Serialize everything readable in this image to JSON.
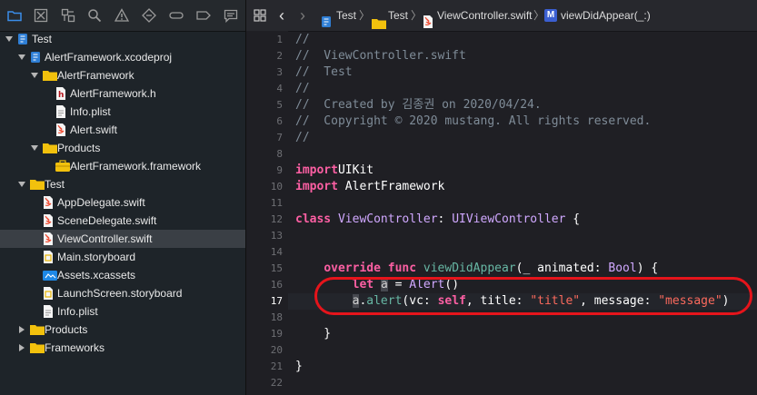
{
  "navigator": {
    "toolbar_icons": [
      "folder-icon",
      "source-control-icon",
      "symbol-icon",
      "find-icon",
      "issue-icon",
      "test-icon",
      "debug-icon",
      "breakpoint-icon",
      "report-icon"
    ],
    "tree": [
      {
        "label": "Test",
        "icon": "project-file",
        "depth": 0,
        "expanded": true
      },
      {
        "label": "AlertFramework.xcodeproj",
        "icon": "project-file",
        "depth": 1,
        "expanded": true
      },
      {
        "label": "AlertFramework",
        "icon": "folder",
        "depth": 2,
        "expanded": true
      },
      {
        "label": "AlertFramework.h",
        "icon": "header-file",
        "depth": 3
      },
      {
        "label": "Info.plist",
        "icon": "plist-file",
        "depth": 3
      },
      {
        "label": "Alert.swift",
        "icon": "swift-file",
        "depth": 3
      },
      {
        "label": "Products",
        "icon": "folder",
        "depth": 2,
        "expanded": true
      },
      {
        "label": "AlertFramework.framework",
        "icon": "framework-file",
        "depth": 3
      },
      {
        "label": "Test",
        "icon": "folder",
        "depth": 1,
        "expanded": true
      },
      {
        "label": "AppDelegate.swift",
        "icon": "swift-file",
        "depth": 2
      },
      {
        "label": "SceneDelegate.swift",
        "icon": "swift-file",
        "depth": 2
      },
      {
        "label": "ViewController.swift",
        "icon": "swift-file",
        "depth": 2,
        "selected": true
      },
      {
        "label": "Main.storyboard",
        "icon": "storyboard-file",
        "depth": 2
      },
      {
        "label": "Assets.xcassets",
        "icon": "assets-file",
        "depth": 2
      },
      {
        "label": "LaunchScreen.storyboard",
        "icon": "storyboard-file",
        "depth": 2
      },
      {
        "label": "Info.plist",
        "icon": "plist-file",
        "depth": 2
      },
      {
        "label": "Products",
        "icon": "folder",
        "depth": 1,
        "expanded": false
      },
      {
        "label": "Frameworks",
        "icon": "folder",
        "depth": 1,
        "expanded": false
      }
    ]
  },
  "jumpbar": {
    "crumbs": [
      "Test",
      "Test",
      "ViewController.swift",
      "viewDidAppear(_:)"
    ],
    "method_badge": "M"
  },
  "editor": {
    "current_line": 17,
    "lines": [
      {
        "n": "1",
        "t": [
          [
            "cm",
            "//"
          ]
        ]
      },
      {
        "n": "2",
        "t": [
          [
            "cm",
            "//  ViewController.swift"
          ]
        ]
      },
      {
        "n": "3",
        "t": [
          [
            "cm",
            "//  Test"
          ]
        ]
      },
      {
        "n": "4",
        "t": [
          [
            "cm",
            "//"
          ]
        ]
      },
      {
        "n": "5",
        "t": [
          [
            "cm",
            "//  Created by 김종권 on 2020/04/24."
          ]
        ]
      },
      {
        "n": "6",
        "t": [
          [
            "cm",
            "//  Copyright © 2020 mustang. All rights reserved."
          ]
        ]
      },
      {
        "n": "7",
        "t": [
          [
            "cm",
            "//"
          ]
        ]
      },
      {
        "n": "8",
        "t": []
      },
      {
        "n": "9",
        "t": [
          [
            "kw",
            "import"
          ],
          [
            "",
            "UIKit"
          ]
        ]
      },
      {
        "n": "10",
        "t": [
          [
            "kw",
            "import"
          ],
          [
            "",
            " AlertFramework"
          ]
        ]
      },
      {
        "n": "11",
        "t": []
      },
      {
        "n": "12",
        "t": [
          [
            "kw",
            "class"
          ],
          [
            "",
            " "
          ],
          [
            "ty",
            "ViewController"
          ],
          [
            "",
            ": "
          ],
          [
            "ty",
            "UIViewController"
          ],
          [
            "",
            " {"
          ]
        ]
      },
      {
        "n": "13",
        "t": []
      },
      {
        "n": "14",
        "t": []
      },
      {
        "n": "15",
        "t": [
          [
            "",
            "    "
          ],
          [
            "kw",
            "override func"
          ],
          [
            "",
            " "
          ],
          [
            "fn",
            "viewDidAppear"
          ],
          [
            "",
            "(_ animated: "
          ],
          [
            "ty",
            "Bool"
          ],
          [
            "",
            ") {"
          ]
        ]
      },
      {
        "n": "16",
        "t": [
          [
            "",
            "        "
          ],
          [
            "kw",
            "let"
          ],
          [
            "",
            " "
          ],
          [
            "var",
            "a"
          ],
          [
            "",
            " = "
          ],
          [
            "ty",
            "Alert"
          ],
          [
            "",
            "()"
          ]
        ]
      },
      {
        "n": "17",
        "t": [
          [
            "",
            "        "
          ],
          [
            "var",
            "a"
          ],
          [
            "",
            "."
          ],
          [
            "fn",
            "alert"
          ],
          [
            "",
            "(vc: "
          ],
          [
            "kw",
            "self"
          ],
          [
            "",
            ", title: "
          ],
          [
            "str",
            "\"title\""
          ],
          [
            "",
            ", message: "
          ],
          [
            "str",
            "\"message\""
          ],
          [
            "",
            ")"
          ]
        ]
      },
      {
        "n": "18",
        "t": []
      },
      {
        "n": "19",
        "t": [
          [
            "",
            "    }"
          ]
        ]
      },
      {
        "n": "20",
        "t": []
      },
      {
        "n": "21",
        "t": [
          [
            "",
            "}"
          ]
        ]
      },
      {
        "n": "22",
        "t": []
      }
    ]
  },
  "colors": {
    "annotation": "#e5141b",
    "folder": "#f2c10d",
    "swift": "#f05138",
    "accent": "#1e88e5"
  }
}
